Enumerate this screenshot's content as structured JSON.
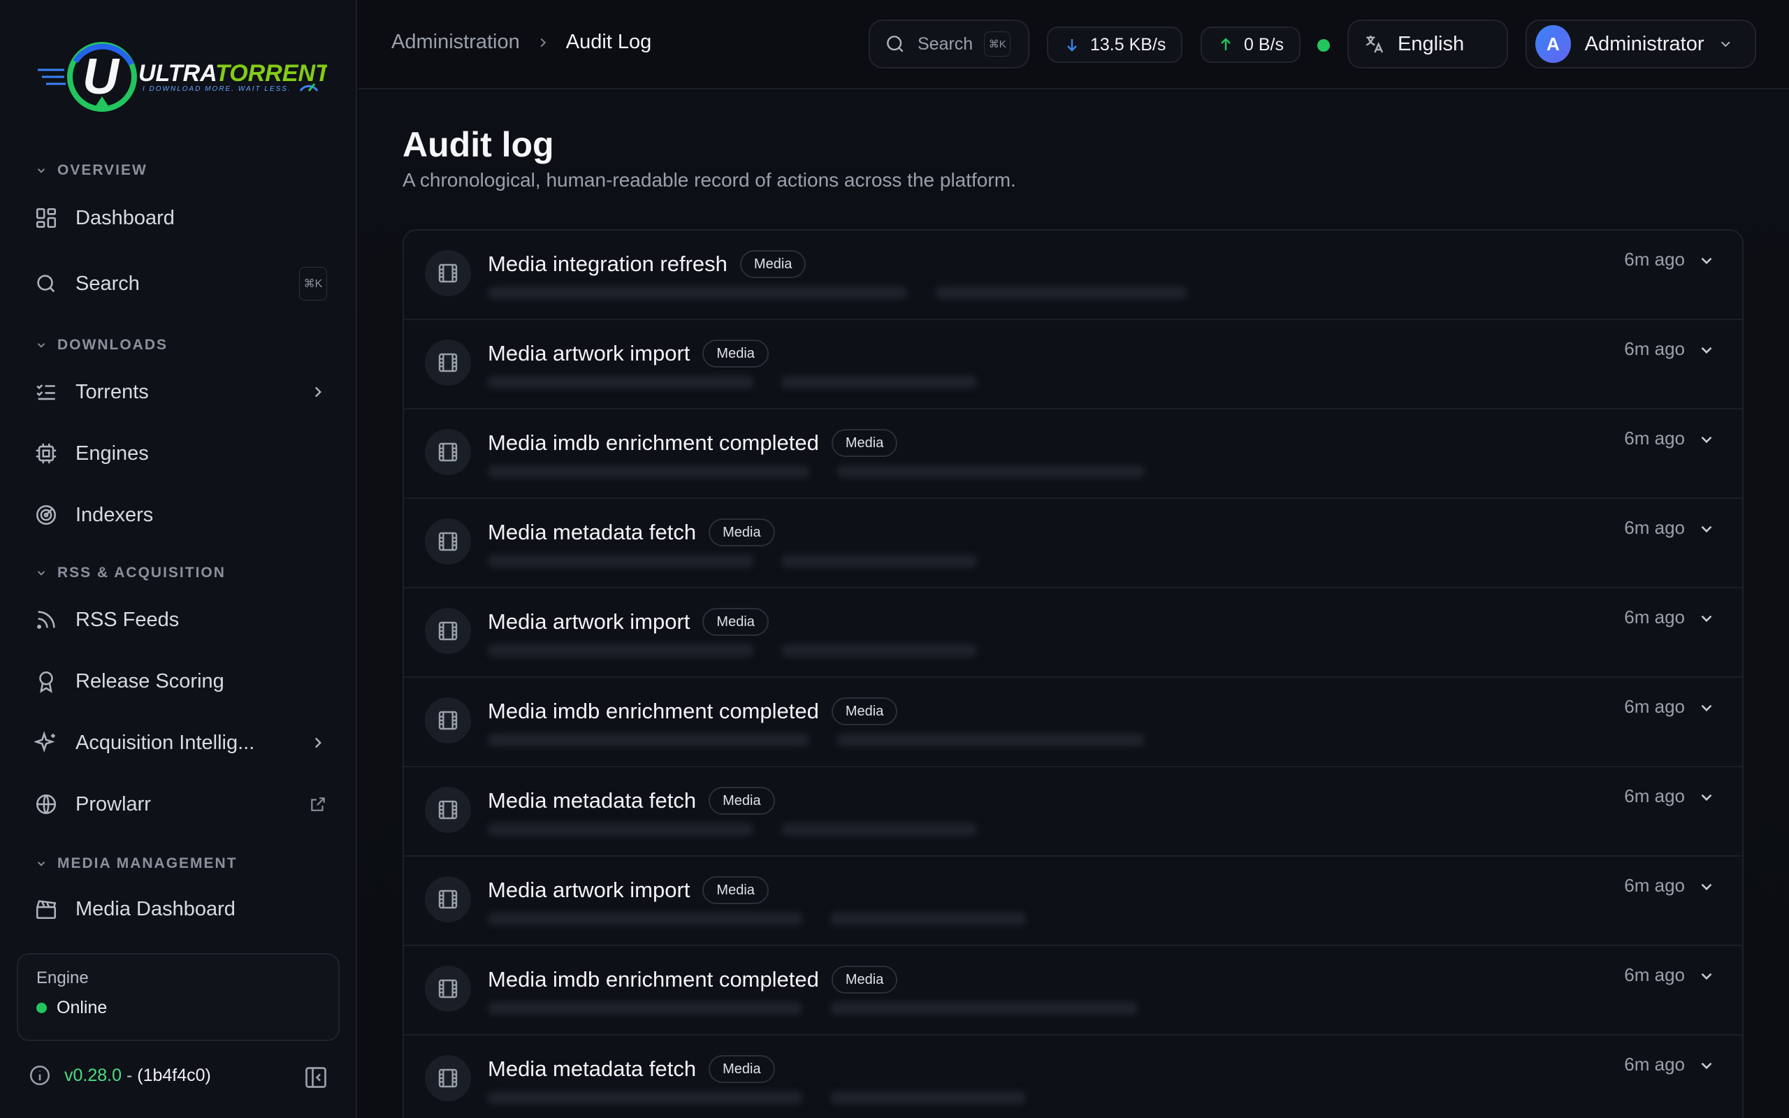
{
  "brand": {
    "name": "ULTRATORRENT",
    "tagline": "I DOWNLOAD MORE. WAIT LESS."
  },
  "sidebar": {
    "sections": [
      {
        "label": "OVERVIEW"
      },
      {
        "label": "DOWNLOADS"
      },
      {
        "label": "RSS & ACQUISITION"
      },
      {
        "label": "MEDIA MANAGEMENT"
      }
    ],
    "items": [
      {
        "label": "Dashboard",
        "icon": "grid-icon"
      },
      {
        "label": "Search",
        "icon": "search-icon",
        "shortcut": "⌘K"
      },
      {
        "label": "Torrents",
        "icon": "list-check-icon"
      },
      {
        "label": "Engines",
        "icon": "cpu-icon"
      },
      {
        "label": "Indexers",
        "icon": "radar-icon"
      },
      {
        "label": "RSS Feeds",
        "icon": "rss-icon"
      },
      {
        "label": "Release Scoring",
        "icon": "award-icon"
      },
      {
        "label": "Acquisition Intellig...",
        "icon": "sparkles-icon"
      },
      {
        "label": "Prowlarr",
        "icon": "globe-icon"
      },
      {
        "label": "Media Dashboard",
        "icon": "clapperboard-icon"
      }
    ],
    "engine": {
      "label": "Engine",
      "status": "Online"
    },
    "version": {
      "number": "v0.28.0",
      "separator": "-",
      "hash": "(1b4f4c0)"
    }
  },
  "header": {
    "breadcrumb": {
      "parent": "Administration",
      "current": "Audit Log"
    },
    "search": {
      "placeholder": "Search",
      "shortcut": "⌘K"
    },
    "download_speed": "13.5 KB/s",
    "upload_speed": "0 B/s",
    "language": "English",
    "user": {
      "initial": "A",
      "name": "Administrator"
    }
  },
  "page": {
    "title": "Audit log",
    "subtitle": "A chronological, human-readable record of actions across the platform."
  },
  "log": {
    "entries": [
      {
        "title": "Media integration refresh",
        "badge": "Media",
        "time": "6m ago"
      },
      {
        "title": "Media artwork import",
        "badge": "Media",
        "time": "6m ago"
      },
      {
        "title": "Media imdb enrichment completed",
        "badge": "Media",
        "time": "6m ago"
      },
      {
        "title": "Media metadata fetch",
        "badge": "Media",
        "time": "6m ago"
      },
      {
        "title": "Media artwork import",
        "badge": "Media",
        "time": "6m ago"
      },
      {
        "title": "Media imdb enrichment completed",
        "badge": "Media",
        "time": "6m ago"
      },
      {
        "title": "Media metadata fetch",
        "badge": "Media",
        "time": "6m ago"
      },
      {
        "title": "Media artwork import",
        "badge": "Media",
        "time": "6m ago"
      },
      {
        "title": "Media imdb enrichment completed",
        "badge": "Media",
        "time": "6m ago"
      },
      {
        "title": "Media metadata fetch",
        "badge": "Media",
        "time": "6m ago"
      }
    ]
  },
  "colors": {
    "accent_green": "#22c55e",
    "version_green": "#4ade80",
    "avatar_blue": "#3b82f6"
  }
}
